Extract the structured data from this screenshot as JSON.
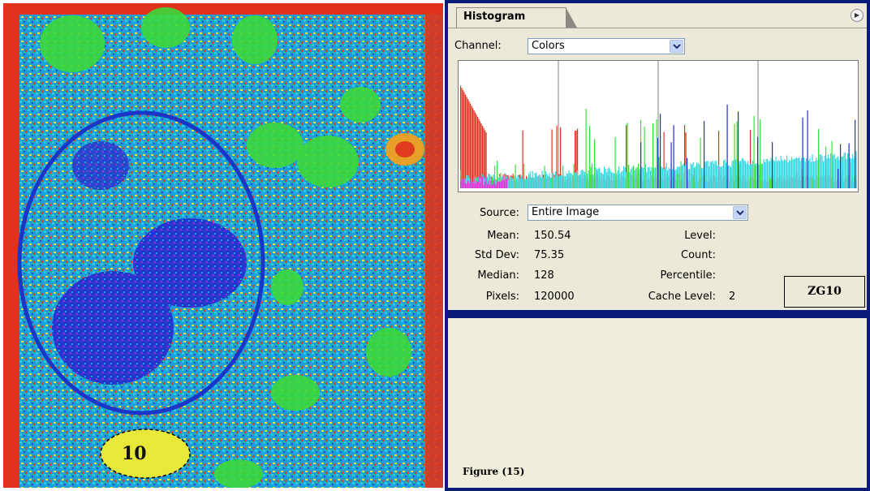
{
  "panel": {
    "tab_label": "Histogram",
    "channel_label": "Channel:",
    "channel_value": "Colors",
    "source_label": "Source:",
    "source_value": "Entire Image"
  },
  "stats": {
    "mean_label": "Mean:",
    "mean_value": "150.54",
    "std_dev_label": "Std Dev:",
    "std_dev_value": "75.35",
    "median_label": "Median:",
    "median_value": "128",
    "pixels_label": "Pixels:",
    "pixels_value": "120000",
    "level_label": "Level:",
    "count_label": "Count:",
    "percentile_label": "Percentile:",
    "cache_level_label": "Cache Level:",
    "cache_level_value": "2"
  },
  "image": {
    "selection_label": "10"
  },
  "annotations": {
    "sample_id": "ZG10",
    "figure_caption": "Figure (15)"
  },
  "icons": {
    "panel_menu": "menu-arrow-icon",
    "dropdown": "chevron-down-icon"
  },
  "colors": {
    "frame": "#0a1a78",
    "panel_bg": "#ece9d8",
    "red_channel": "#e0301e",
    "green_channel": "#3ce03c",
    "blue_channel": "#2030c8",
    "cyan_overlap": "#30d8e0",
    "magenta_overlap": "#e030e0"
  }
}
